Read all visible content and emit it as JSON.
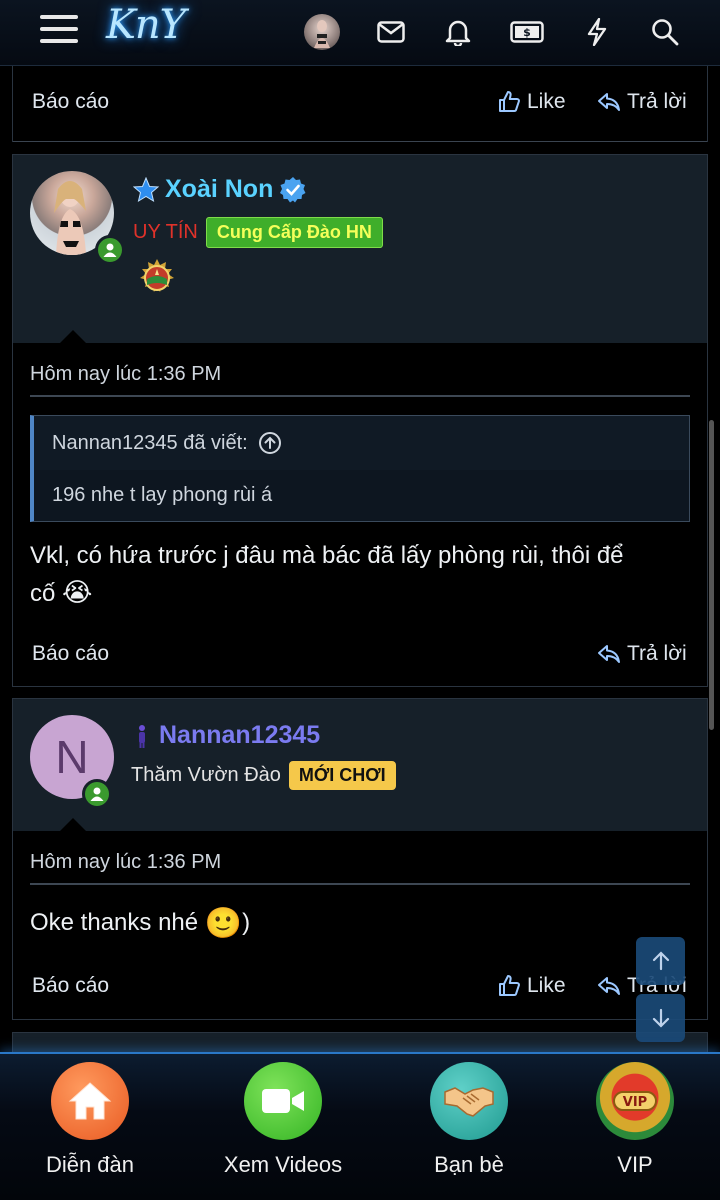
{
  "header": {
    "logo_text": "KnY",
    "icons": [
      "menu-icon",
      "user-avatar",
      "mail-icon",
      "bell-icon",
      "money-icon",
      "lightning-icon",
      "search-icon"
    ]
  },
  "prev_post_footer": {
    "report": "Báo cáo",
    "like": "Like",
    "reply": "Trả lời"
  },
  "posts": [
    {
      "username": "Xoài Non",
      "username_color": "#5ad2ff",
      "verified": true,
      "title_label": "UY TÍN",
      "title_color": "#e0322a",
      "badge": "Cung Cấp Đào HN",
      "badge_bg": "#3fae2a",
      "badge_color": "#f4ff5a",
      "date": "Hôm nay lúc 1:36 PM",
      "quote": {
        "author_line": "Nannan12345 đã viết:",
        "text": "196 nhe t lay phong rùi á"
      },
      "message_line1": "Vkl, có hứa trước j đâu mà bác đã lấy phòng rùi, thôi để",
      "message_line2": "cố",
      "message_emoji": "😭",
      "report": "Báo cáo",
      "reply": "Trả lời"
    },
    {
      "username": "Nannan12345",
      "username_color": "#7b7bf0",
      "avatar_letter": "N",
      "title_label": "Thăm Vườn Đào",
      "badge": "MỚI CHƠI",
      "badge_bg": "#f5c84a",
      "badge_color": "#111111",
      "date": "Hôm nay lúc 1:36 PM",
      "message": "Oke thanks nhé",
      "message_emoji": "🙂",
      "message_tail": ")",
      "report": "Báo cáo",
      "like": "Like",
      "reply": "Trả lời"
    }
  ],
  "bottom_nav": [
    {
      "label": "Diễn đàn",
      "icon": "home-icon"
    },
    {
      "label": "Xem Videos",
      "icon": "video-camera-icon"
    },
    {
      "label": "Bạn bè",
      "icon": "handshake-icon"
    },
    {
      "label": "VIP",
      "icon": "vip-medal-icon"
    }
  ],
  "colors": {
    "header_bg": "#0b1420",
    "post_head_bg": "#162029",
    "accent_blue": "#2a78c8",
    "online_green": "#3a9a2e"
  }
}
